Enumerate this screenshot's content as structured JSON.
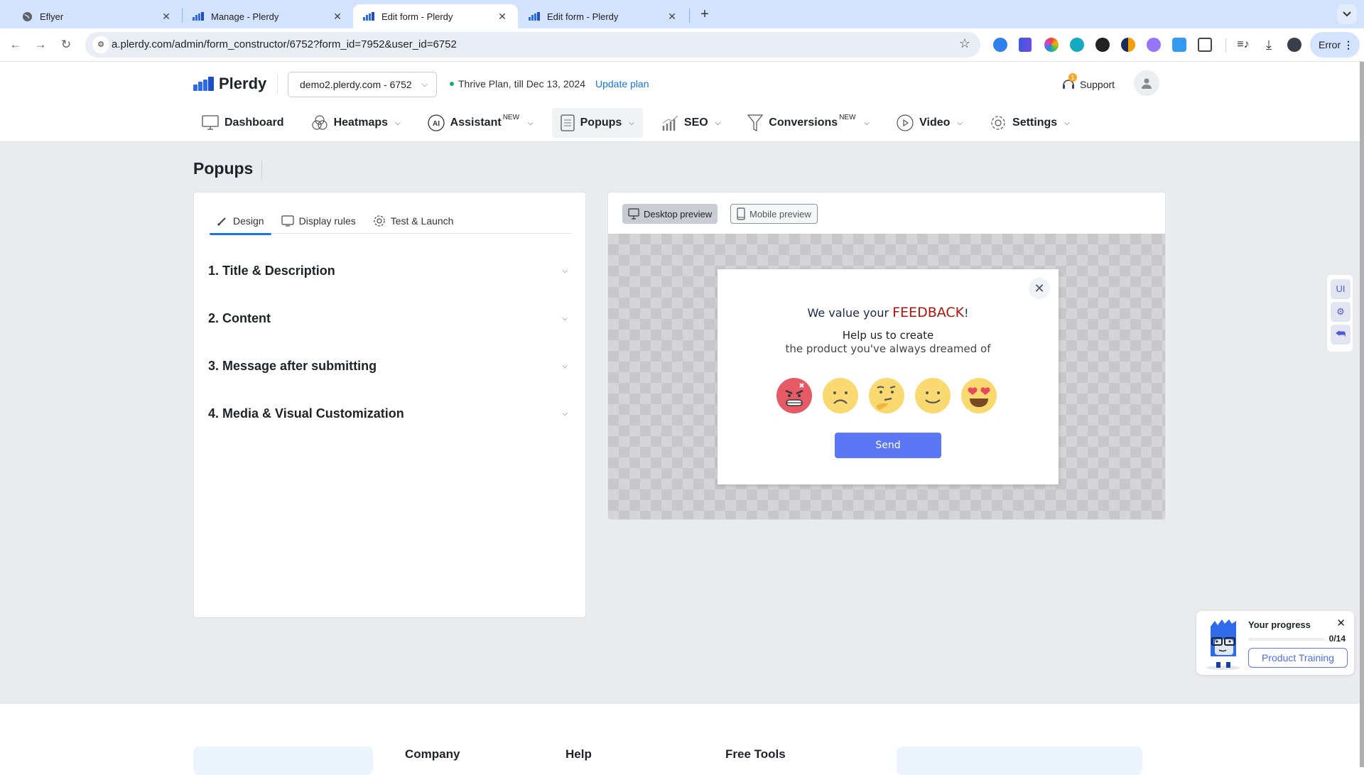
{
  "browser": {
    "tabs": [
      {
        "title": "Eflyer",
        "icon": "globe-icon",
        "active": false
      },
      {
        "title": "Manage - Plerdy",
        "icon": "plerdy-icon",
        "active": false
      },
      {
        "title": "Edit form - Plerdy",
        "icon": "plerdy-icon",
        "active": true
      },
      {
        "title": "Edit form - Plerdy",
        "icon": "plerdy-icon",
        "active": false
      }
    ],
    "new_tab": "+",
    "tab_menu": "⌄",
    "url": "a.plerdy.com/admin/form_constructor/6752?form_id=7952&user_id=6752",
    "error_label": "Error",
    "back": "←",
    "forward": "→",
    "reload": "↻"
  },
  "header": {
    "logo_text": "Plerdy",
    "site_selector": "demo2.plerdy.com - 6752",
    "plan_text": "Thrive Plan, till Dec 13, 2024",
    "update_plan": "Update plan",
    "support_label": "Support",
    "support_badge": "1",
    "nav": [
      {
        "label": "Dashboard",
        "icon": "monitor-icon",
        "badge": "",
        "dropdown": false
      },
      {
        "label": "Heatmaps",
        "icon": "heatmaps-icon",
        "badge": "",
        "dropdown": true
      },
      {
        "label": "Assistant",
        "icon": "ai-icon",
        "badge": "NEW",
        "dropdown": true
      },
      {
        "label": "Popups",
        "icon": "document-icon",
        "badge": "",
        "dropdown": true,
        "active": true
      },
      {
        "label": "SEO",
        "icon": "chart-icon",
        "badge": "",
        "dropdown": true
      },
      {
        "label": "Conversions",
        "icon": "funnel-icon",
        "badge": "NEW",
        "dropdown": true
      },
      {
        "label": "Video",
        "icon": "play-icon",
        "badge": "",
        "dropdown": true
      },
      {
        "label": "Settings",
        "icon": "gear-icon",
        "badge": "",
        "dropdown": true
      }
    ]
  },
  "page": {
    "title": "Popups",
    "tabs": [
      {
        "label": "Design",
        "icon": "brush-icon",
        "active": true
      },
      {
        "label": "Display rules",
        "icon": "screen-icon",
        "active": false
      },
      {
        "label": "Test & Launch",
        "icon": "gear-icon",
        "active": false
      }
    ],
    "sections": [
      {
        "label": "1. Title & Description"
      },
      {
        "label": "2. Content"
      },
      {
        "label": "3. Message after submitting"
      },
      {
        "label": "4. Media & Visual Customization"
      }
    ],
    "preview": {
      "desktop_label": "Desktop preview",
      "mobile_label": "Mobile preview",
      "mode": "desktop"
    },
    "popup": {
      "heading_prefix": "We value your ",
      "heading_accent": "FEEDBACK",
      "heading_suffix": "!",
      "subheading_line1": "Help us to create",
      "subheading_line2": "the product you've always dreamed of",
      "emojis": [
        "angry",
        "sad",
        "thinking",
        "smile",
        "heart-eyes"
      ],
      "send_label": "Send",
      "accent_color": "#b0150c",
      "button_color": "#5b77f5"
    }
  },
  "float_tools": {
    "ui_label": "UI"
  },
  "progress_widget": {
    "title": "Your progress",
    "count": "0/14",
    "completed": 0,
    "total": 14,
    "button_label": "Product Training"
  },
  "footer": {
    "columns": [
      "Company",
      "Help",
      "Free Tools"
    ]
  }
}
